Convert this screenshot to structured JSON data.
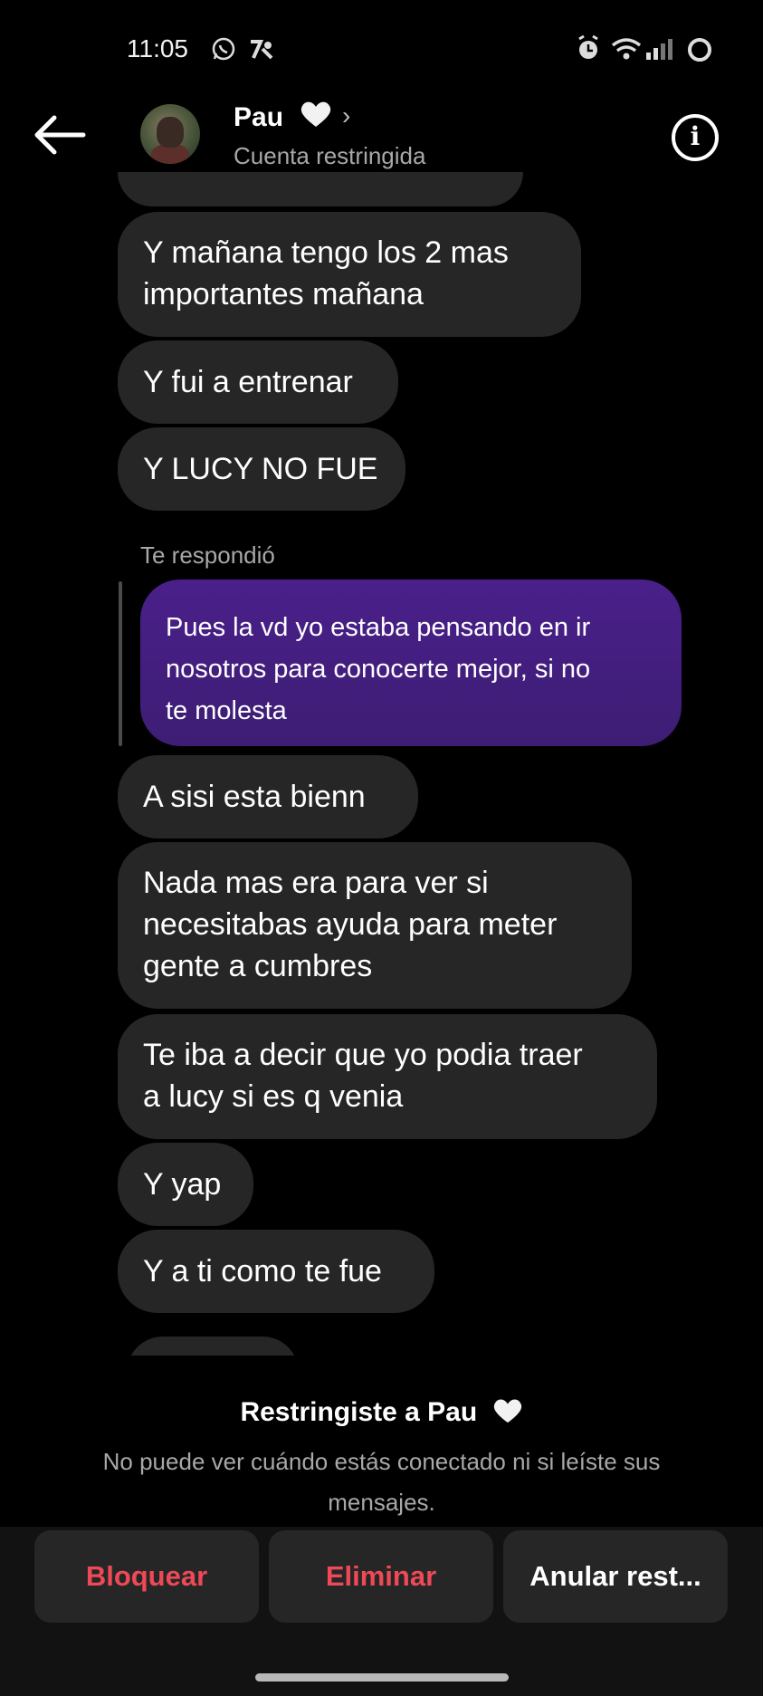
{
  "status_bar": {
    "time": "11:05"
  },
  "header": {
    "contact_name": "Pau",
    "subtitle": "Cuenta restringida"
  },
  "messages": [
    {
      "lines": [
        "Y mañana tengo los 2 mas",
        "importantes mañana"
      ]
    },
    {
      "lines": [
        "Y fui a entrenar"
      ]
    },
    {
      "lines": [
        "Y LUCY NO FUE"
      ]
    },
    {
      "lines": [
        "A sisi esta bienn"
      ]
    },
    {
      "lines": [
        "Nada mas era para ver si",
        "necesitabas ayuda para meter",
        "gente a cumbres"
      ]
    },
    {
      "lines": [
        "Te iba a decir que yo podia traer",
        "a lucy si es q venia"
      ]
    },
    {
      "lines": [
        "Y yap"
      ]
    },
    {
      "lines": [
        "Y a ti como te fue"
      ]
    }
  ],
  "reply": {
    "label": "Te respondió",
    "lines": [
      "Pues la vd yo estaba pensando en ir",
      "nosotros para conocerte mejor, si no",
      "te molesta"
    ]
  },
  "restriction": {
    "title": "Restringiste a Pau",
    "description": "No puede ver cuándo estás conectado ni si leíste sus mensajes."
  },
  "actions": {
    "block": "Bloquear",
    "delete": "Eliminar",
    "unrestrict": "Anular rest..."
  },
  "colors": {
    "background": "#000000",
    "bubble": "#262626",
    "reply_bubble": "#4a1f8a",
    "danger": "#ed4956",
    "secondary_text": "#a8a8a8"
  }
}
